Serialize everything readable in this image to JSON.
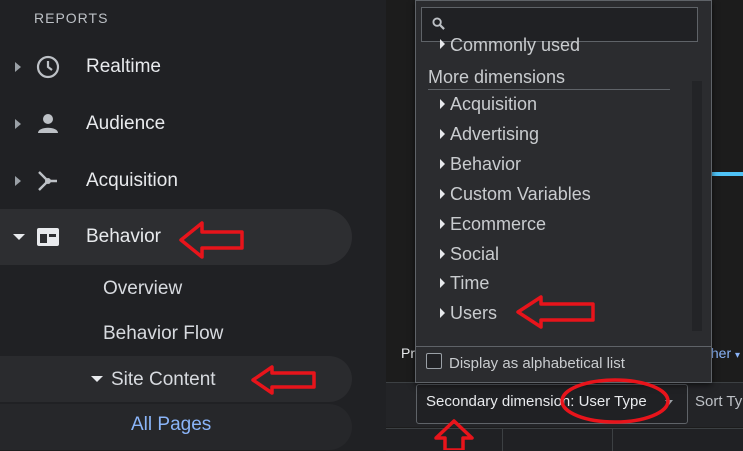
{
  "sidebar": {
    "section_title": "REPORTS",
    "items": [
      {
        "label": "Realtime",
        "icon": "clock-icon"
      },
      {
        "label": "Audience",
        "icon": "person-icon"
      },
      {
        "label": "Acquisition",
        "icon": "acquisition-icon"
      },
      {
        "label": "Behavior",
        "icon": "behavior-icon"
      }
    ],
    "behavior_children": {
      "overview": "Overview",
      "behavior_flow": "Behavior Flow",
      "site_content": "Site Content",
      "all_pages": "All Pages"
    }
  },
  "dropdown": {
    "search_placeholder": "",
    "partial_row": "Commonly used",
    "heading": "More dimensions",
    "items": [
      "Acquisition",
      "Advertising",
      "Behavior",
      "Custom Variables",
      "Ecommerce",
      "Social",
      "Time",
      "Users"
    ],
    "alphabetical_label": "Display as alphabetical list"
  },
  "main": {
    "partial_left_text": "Pr",
    "partial_right_text": "ther",
    "secondary_dimension_label": "Secondary dimension: User Type",
    "sort_label": "Sort Ty"
  },
  "colors": {
    "annotation": "#e8141b",
    "link": "#8ab4f8",
    "chart_line": "#4fc3f7"
  }
}
